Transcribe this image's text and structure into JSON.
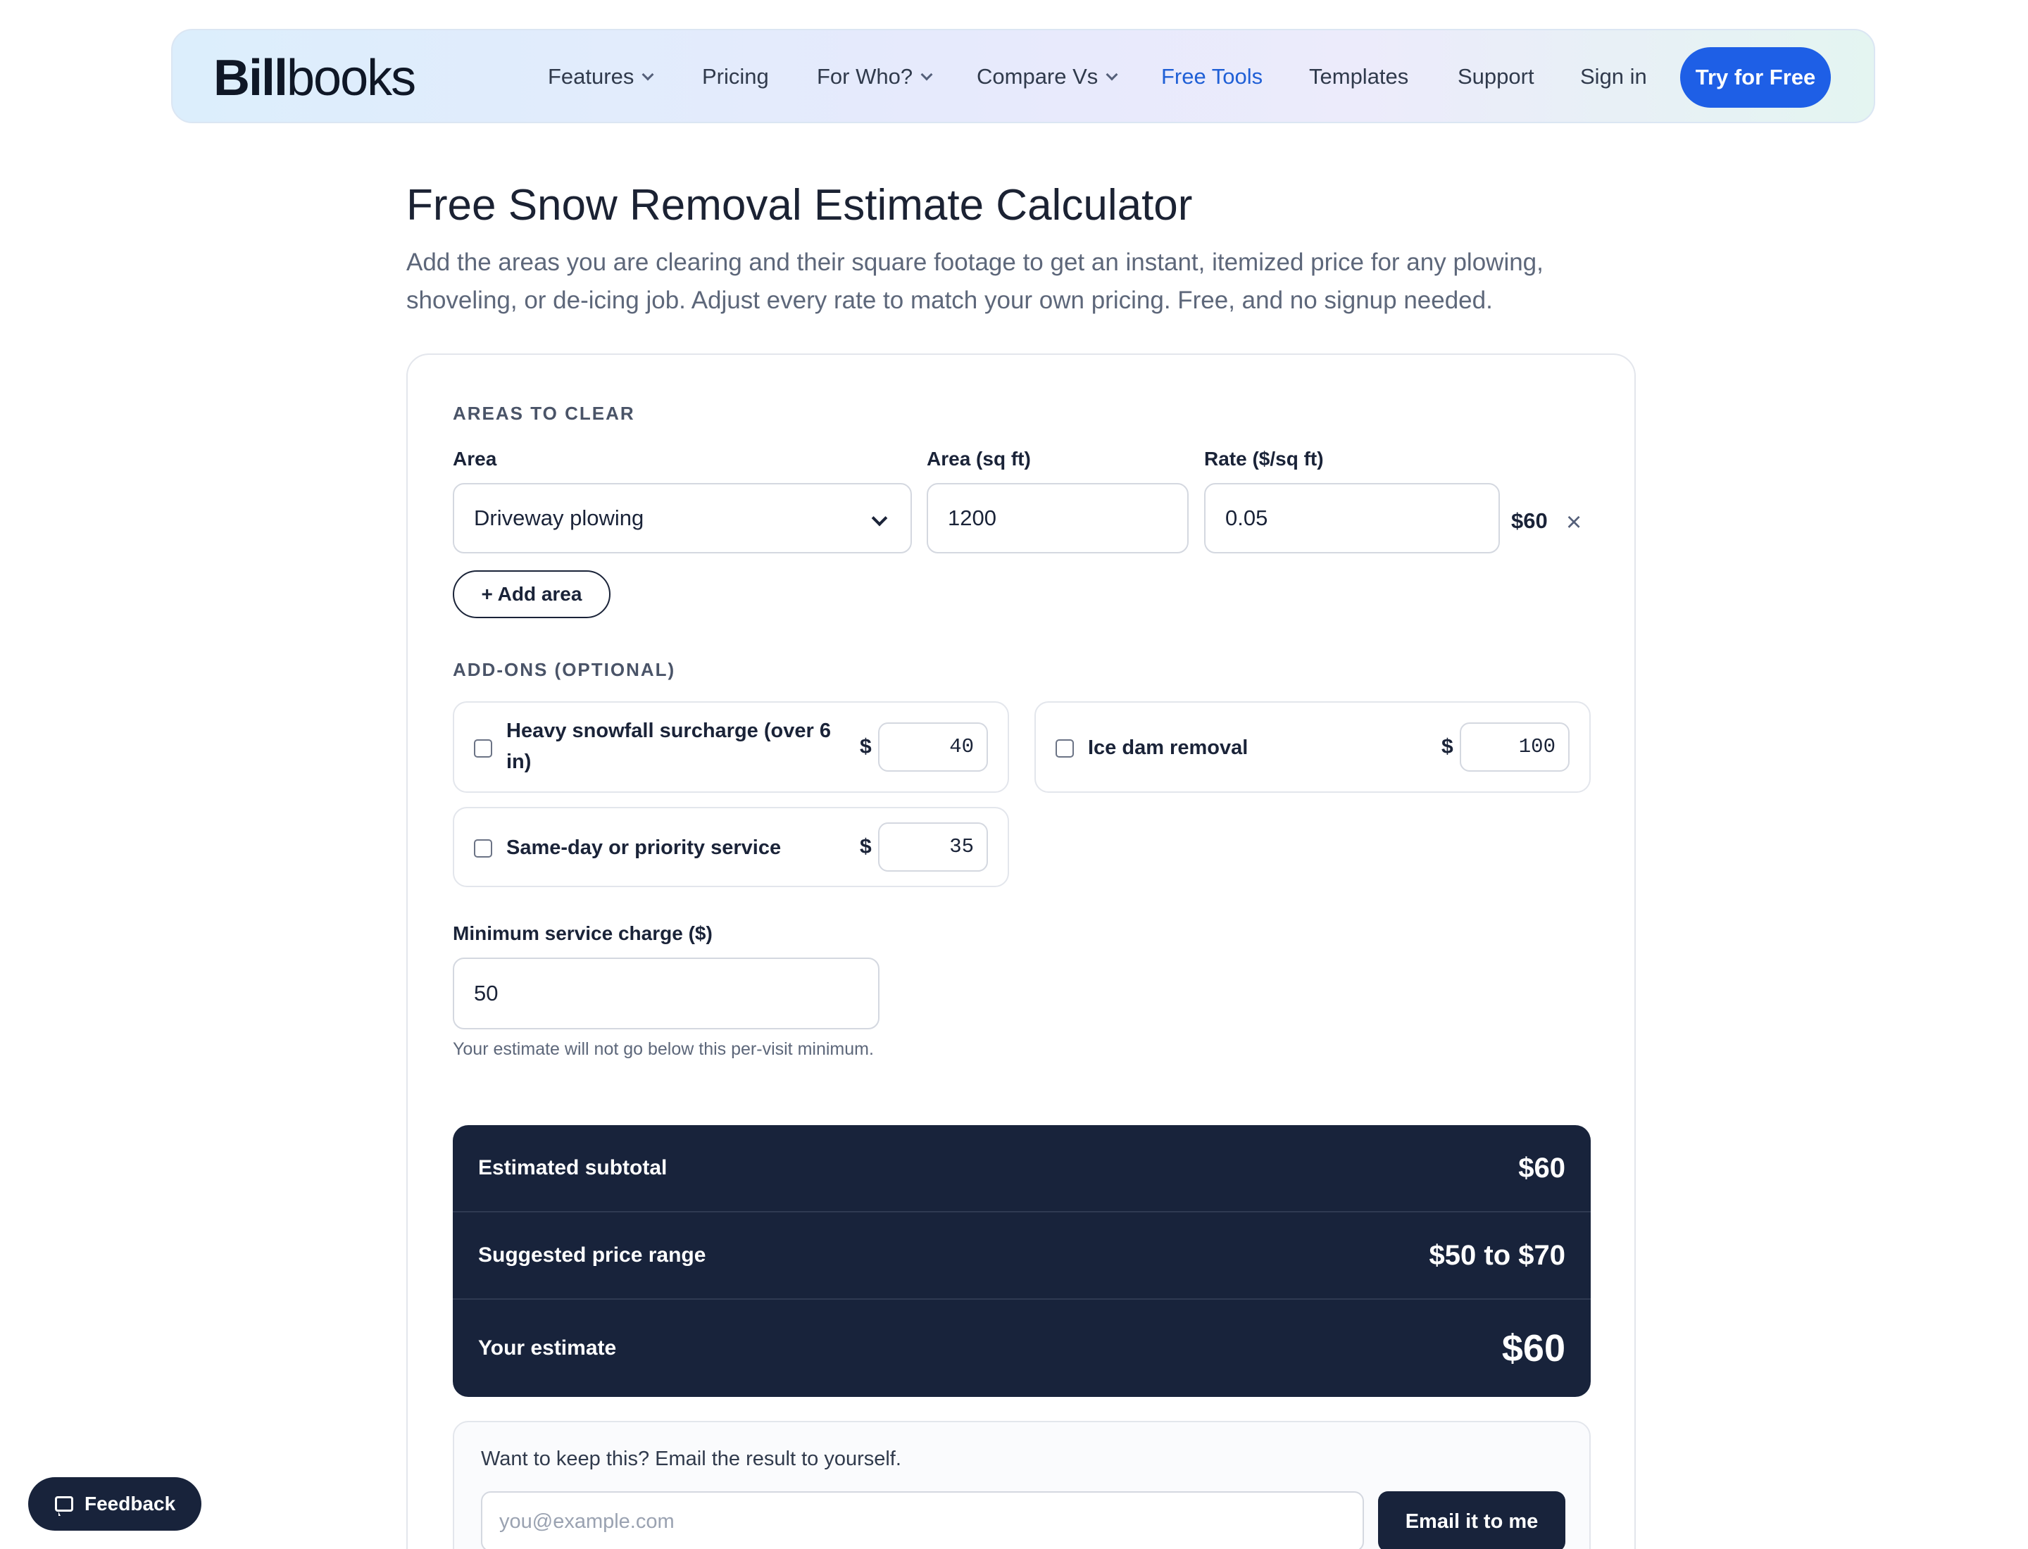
{
  "header": {
    "logo_bold": "Bill",
    "logo_light": "books",
    "nav": [
      {
        "label": "Features",
        "has_dropdown": true
      },
      {
        "label": "Pricing",
        "has_dropdown": false
      },
      {
        "label": "For Who?",
        "has_dropdown": true
      },
      {
        "label": "Compare Vs",
        "has_dropdown": true
      },
      {
        "label": "Free Tools",
        "has_dropdown": false,
        "active": true
      },
      {
        "label": "Templates",
        "has_dropdown": false
      },
      {
        "label": "Support",
        "has_dropdown": false
      },
      {
        "label": "Sign in",
        "has_dropdown": false
      }
    ],
    "cta_label": "Try for Free",
    "accent_color": "#1e5fe6"
  },
  "page": {
    "title": "Free Snow Removal Estimate Calculator",
    "subtitle": "Add the areas you are clearing and their square footage to get an instant, itemized price for any plowing, shoveling, or de-icing job. Adjust every rate to match your own pricing. Free, and no signup needed."
  },
  "areas": {
    "section_label": "AREAS TO CLEAR",
    "col_area": "Area",
    "col_sqft": "Area (sq ft)",
    "col_rate": "Rate ($/sq ft)",
    "rows": [
      {
        "area": "Driveway plowing",
        "sqft": "1200",
        "rate": "0.05",
        "total": "$60",
        "remove_icon": "×"
      }
    ],
    "add_label": "+ Add area"
  },
  "addons": {
    "section_label": "ADD-ONS (OPTIONAL)",
    "currency": "$",
    "items": [
      {
        "label": "Heavy snowfall surcharge (over 6 in)",
        "value": "40",
        "checked": false
      },
      {
        "label": "Ice dam removal",
        "value": "100",
        "checked": false
      },
      {
        "label": "Same-day or priority service",
        "value": "35",
        "checked": false
      }
    ]
  },
  "minimum": {
    "label": "Minimum service charge ($)",
    "value": "50",
    "help": "Your estimate will not go below this per-visit minimum."
  },
  "summary": {
    "subtotal_label": "Estimated subtotal",
    "subtotal_value": "$60",
    "range_label": "Suggested price range",
    "range_value": "$50 to $70",
    "estimate_label": "Your estimate",
    "estimate_value": "$60",
    "bg_color": "#18233b"
  },
  "email": {
    "prompt": "Want to keep this? Email the result to yourself.",
    "placeholder": "you@example.com",
    "button": "Email it to me"
  },
  "feedback": {
    "label": "Feedback",
    "icon": "chat-bubble-icon"
  }
}
